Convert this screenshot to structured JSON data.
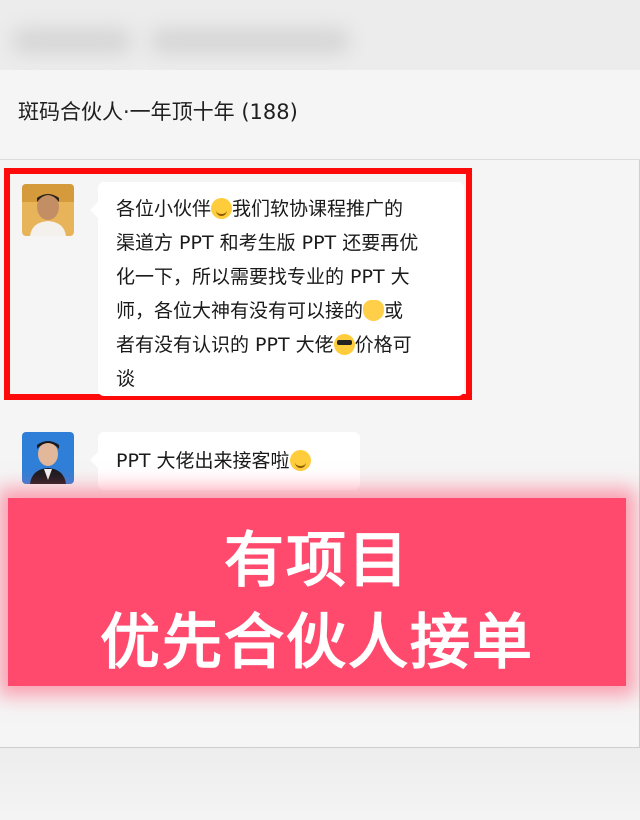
{
  "chat": {
    "title": "斑码合伙人·一年顶十年 (188)"
  },
  "messages": [
    {
      "lines": [
        [
          "各位小伙伴",
          "我们软协课程推广的"
        ],
        [
          "渠道方 PPT 和考生版 PPT 还要再优"
        ],
        [
          "化一下，所以需要找专业的 PPT 大"
        ],
        [
          "师，各位大神有没有可以接的",
          "或"
        ],
        [
          "者有没有认识的 PPT 大佬",
          "价格可"
        ],
        [
          "谈"
        ]
      ],
      "emojis": [
        "slightly-smiling-emoji-icon",
        "cat-face-emoji-icon",
        "sunglasses-emoji-icon"
      ],
      "highlight_color": "#ff0a0a"
    },
    {
      "text": "PPT 大佬出来接客啦",
      "emoji": "smirk-emoji-icon"
    }
  ],
  "banner": {
    "line1": "有项目",
    "line2": "优先合伙人接单",
    "color": "#ff4a6d"
  }
}
